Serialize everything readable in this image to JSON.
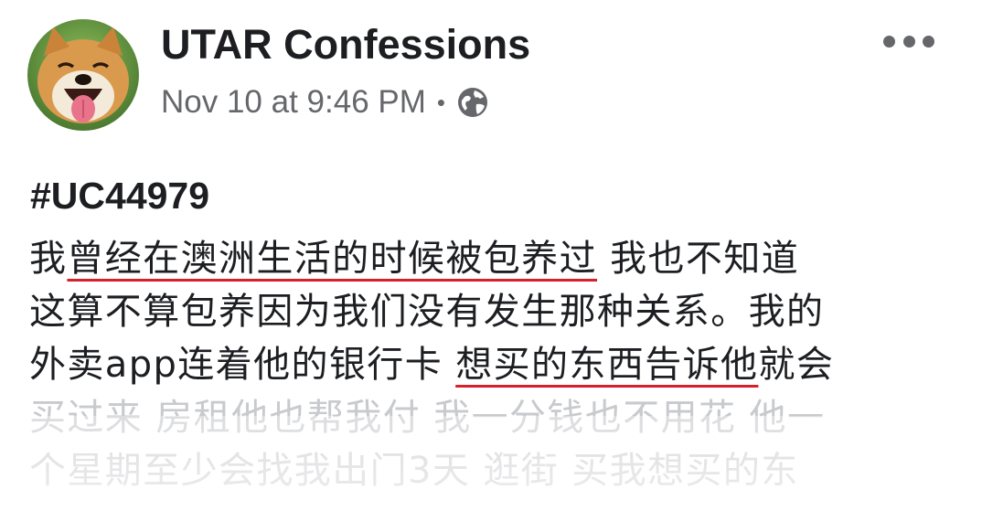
{
  "post": {
    "page_name": "UTAR Confessions",
    "timestamp": "Nov 10 at 9:46 PM",
    "separator": "•",
    "audience_icon": "globe-icon",
    "more_icon": "more-options-icon",
    "hashtag": "#UC44979",
    "lines": [
      {
        "segments": [
          {
            "text": "我",
            "underline": false
          },
          {
            "text": "曾经在澳洲生活的时候被包养过",
            "underline": true
          },
          {
            "text": " 我也不知道",
            "underline": false
          }
        ]
      },
      {
        "segments": [
          {
            "text": "这算不算包养因为我们没有发生那种关系。我的",
            "underline": false
          }
        ]
      },
      {
        "segments": [
          {
            "text": "外卖app连着他的银行卡 ",
            "underline": false
          },
          {
            "text": "想买的东西告诉他",
            "underline": true
          },
          {
            "text": "就会",
            "underline": false
          }
        ]
      }
    ],
    "faded_lines": [
      "买过来 房租他也帮我付 我一分钱也不用花 他一",
      "个星期至少会找我出门3天 逛街 买我想买的东"
    ]
  },
  "colors": {
    "text": "#1c1e21",
    "secondary_text": "#65676b",
    "underline": "#d4212c",
    "faded_text": "#c9cacd"
  }
}
